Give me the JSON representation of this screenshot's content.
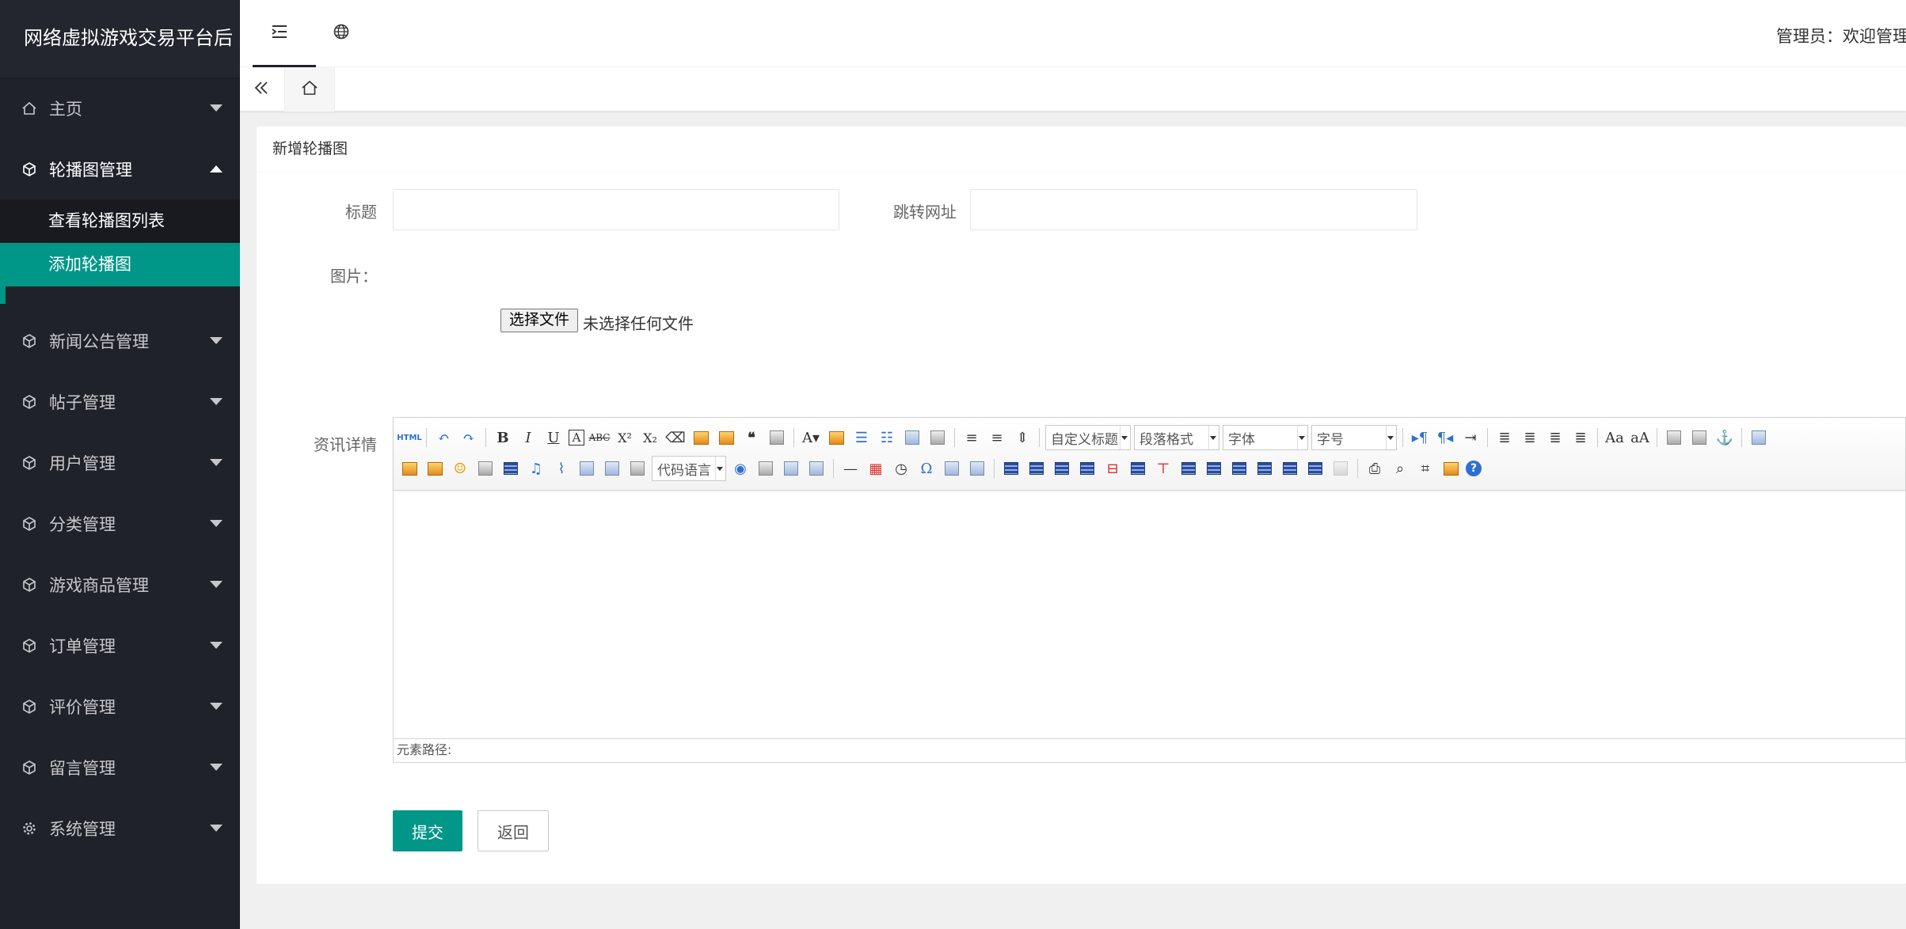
{
  "app": {
    "title": "网络虚拟游戏交易平台后"
  },
  "header": {
    "admin_text": "管理员：欢迎管理员"
  },
  "sidebar": {
    "items": [
      {
        "label": "主页",
        "icon": "home-icon"
      },
      {
        "label": "轮播图管理",
        "icon": "cube-icon",
        "open": true,
        "children": [
          {
            "label": "查看轮播图列表"
          },
          {
            "label": "添加轮播图",
            "active": true
          }
        ]
      },
      {
        "label": "新闻公告管理",
        "icon": "cube-icon"
      },
      {
        "label": "帖子管理",
        "icon": "cube-icon"
      },
      {
        "label": "用户管理",
        "icon": "cube-icon"
      },
      {
        "label": "分类管理",
        "icon": "cube-icon"
      },
      {
        "label": "游戏商品管理",
        "icon": "cube-icon"
      },
      {
        "label": "订单管理",
        "icon": "cube-icon"
      },
      {
        "label": "评价管理",
        "icon": "cube-icon"
      },
      {
        "label": "留言管理",
        "icon": "cube-icon"
      },
      {
        "label": "系统管理",
        "icon": "gear-icon"
      }
    ]
  },
  "form": {
    "card_title": "新增轮播图",
    "title_label": "标题",
    "title_value": "",
    "url_label": "跳转网址",
    "url_value": "",
    "image_label": "图片：",
    "file_button": "选择文件",
    "file_status": "未选择任何文件",
    "detail_label": "资讯详情",
    "editor": {
      "combo_custom_title": "自定义标题",
      "combo_paragraph": "段落格式",
      "combo_font": "字体",
      "combo_size": "字号",
      "combo_code": "代码语言",
      "path_label": "元素路径:"
    },
    "submit_label": "提交",
    "back_label": "返回"
  },
  "colors": {
    "accent": "#009688",
    "sidebar_bg": "#20222a"
  }
}
